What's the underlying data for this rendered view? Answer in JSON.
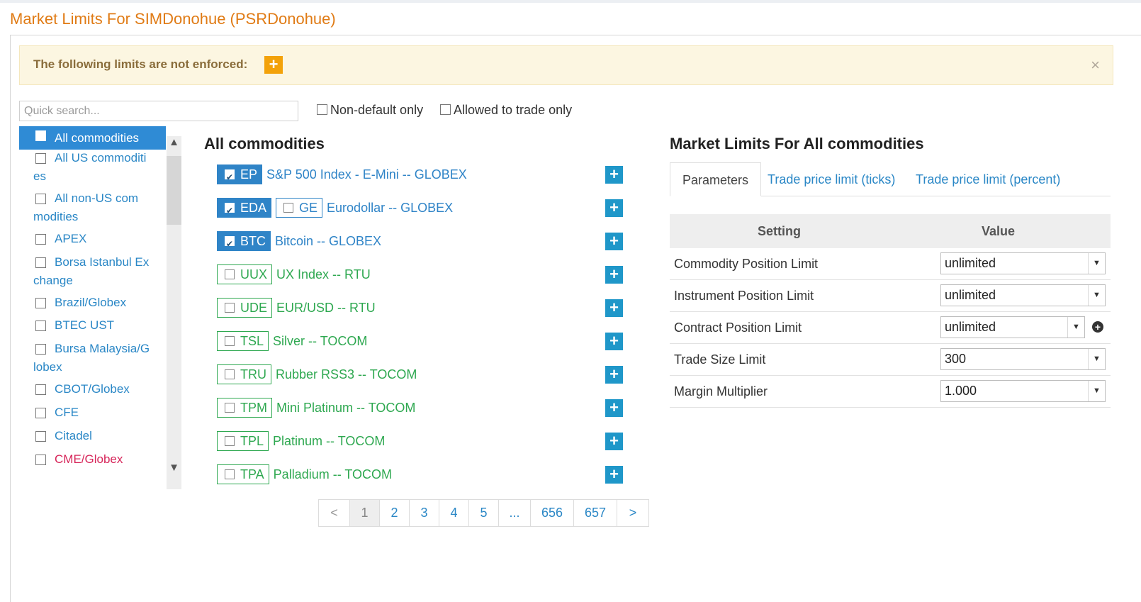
{
  "page_title": "Market Limits For SIMDonohue (PSRDonohue)",
  "alert": {
    "text": "The following limits are not enforced:",
    "plus": "+",
    "close": "×"
  },
  "search": {
    "placeholder": "Quick search..."
  },
  "filters": {
    "non_default": "Non-default only",
    "allowed": "Allowed to trade only"
  },
  "tree": {
    "items": [
      {
        "label": "All commodities"
      },
      {
        "label_line1": "All US commoditi",
        "label_line2": "es"
      },
      {
        "label_line1": "All non-US com",
        "label_line2": "modities"
      },
      {
        "label": "APEX"
      },
      {
        "label_line1": "Borsa Istanbul Ex",
        "label_line2": "change"
      },
      {
        "label": "Brazil/Globex"
      },
      {
        "label": "BTEC UST"
      },
      {
        "label_line1": "Bursa Malaysia/G",
        "label_line2": "lobex"
      },
      {
        "label": "CBOT/Globex"
      },
      {
        "label": "CFE"
      },
      {
        "label": "Citadel"
      },
      {
        "label": "CME/Globex"
      }
    ]
  },
  "middle": {
    "heading": "All commodities",
    "rows": [
      {
        "code": "EP",
        "name": "S&P 500 Index - E-Mini -- GLOBEX"
      },
      {
        "code": "EDA",
        "code2": "GE",
        "name": "Eurodollar -- GLOBEX"
      },
      {
        "code": "BTC",
        "name": "Bitcoin -- GLOBEX"
      },
      {
        "code": "UUX",
        "name": "UX Index -- RTU"
      },
      {
        "code": "UDE",
        "name": "EUR/USD -- RTU"
      },
      {
        "code": "TSL",
        "name": "Silver -- TOCOM"
      },
      {
        "code": "TRU",
        "name": "Rubber RSS3 -- TOCOM"
      },
      {
        "code": "TPM",
        "name": "Mini Platinum -- TOCOM"
      },
      {
        "code": "TPL",
        "name": "Platinum -- TOCOM"
      },
      {
        "code": "TPA",
        "name": "Palladium -- TOCOM"
      }
    ],
    "plus": "+"
  },
  "pagination": {
    "prev": "<",
    "pages": [
      "1",
      "2",
      "3",
      "4",
      "5",
      "...",
      "656",
      "657"
    ],
    "next": ">"
  },
  "right": {
    "heading": "Market Limits For All commodities",
    "tabs": [
      "Parameters",
      "Trade price limit (ticks)",
      "Trade price limit (percent)"
    ],
    "columns": [
      "Setting",
      "Value"
    ],
    "rows": [
      {
        "setting": "Commodity Position Limit",
        "value": "unlimited"
      },
      {
        "setting": "Instrument Position Limit",
        "value": "unlimited"
      },
      {
        "setting": "Contract Position Limit",
        "value": "unlimited"
      },
      {
        "setting": "Trade Size Limit",
        "value": "300"
      },
      {
        "setting": "Margin Multiplier",
        "value": "1.000"
      }
    ]
  },
  "colors": {
    "accent_orange": "#e07b15",
    "link_blue": "#2a87c6",
    "selected_blue": "#2f84c7",
    "green": "#2ea850",
    "plus_blue": "#1f97c9",
    "pink": "#d7265a"
  }
}
